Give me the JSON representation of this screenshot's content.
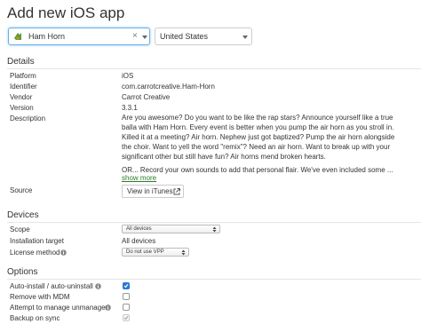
{
  "page_title": "Add new iOS app",
  "app_select": {
    "value": "Ham Horn",
    "clear": "×"
  },
  "country_select": {
    "value": "United States"
  },
  "details": {
    "title": "Details",
    "platform": {
      "label": "Platform",
      "value": "iOS"
    },
    "identifier": {
      "label": "Identifier",
      "value": "com.carrotcreative.Ham-Horn"
    },
    "vendor": {
      "label": "Vendor",
      "value": "Carrot Creative"
    },
    "version": {
      "label": "Version",
      "value": "3.3.1"
    },
    "description": {
      "label": "Description",
      "text": "Are you awesome? Do you want to be like the rap stars? Announce yourself like a true balla with Ham Horn. Every event is better when you pump the air horn as you stroll in. Killed it at a meeting? Air horn. Nephew just got baptized? Pump the air horn alongside the choir. Want to yell the word \"remix\"? Need an air horn. Want to break up with your significant other but still have fun? Air horns mend broken hearts.",
      "text2": "OR... Record your own sounds to add that personal flair. We've even included some ...",
      "show_more": "show more"
    },
    "source": {
      "label": "Source",
      "button": "View in iTunes"
    }
  },
  "devices": {
    "title": "Devices",
    "scope": {
      "label": "Scope",
      "value": "All devices"
    },
    "installation_target": {
      "label": "Installation target",
      "value": "All devices"
    },
    "license_method": {
      "label": "License method",
      "value": "Do not use VPP"
    }
  },
  "options": {
    "title": "Options",
    "items": [
      {
        "label": "Auto-install / auto-uninstall",
        "checked": true
      },
      {
        "label": "Remove with MDM",
        "checked": false
      },
      {
        "label": "Attempt to manage unmanaged",
        "checked": false
      },
      {
        "label": "Backup on sync",
        "checked": true
      }
    ]
  },
  "colors": {
    "link": "#2d7a2d",
    "focus": "#66afe9",
    "checkbox": "#2a78d6"
  },
  "icons": [
    "app-icon",
    "clear-icon",
    "chevron-down-icon",
    "external-link-icon",
    "info-icon",
    "checkmark-icon",
    "updown-arrows-icon"
  ]
}
